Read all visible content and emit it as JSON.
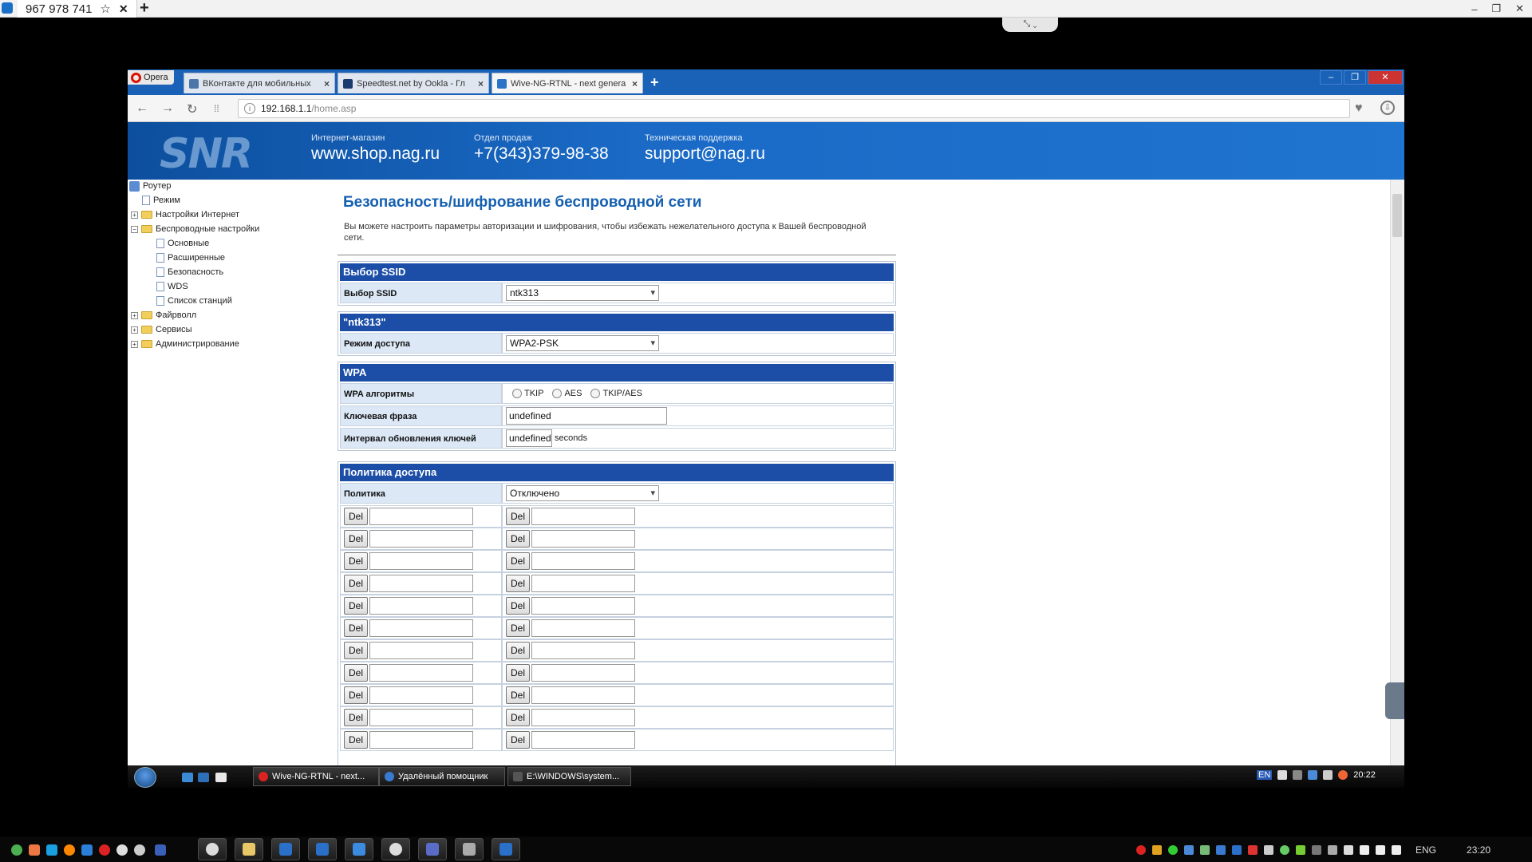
{
  "teamviewer": {
    "tab_label": "967 978 741",
    "star": "☆",
    "close": "✕",
    "plus": "+",
    "minimize": "‒",
    "restore": "❐",
    "close_win": "✕",
    "drop_label": "⤡ ⌄"
  },
  "browser": {
    "opera_label": "Opera",
    "tabs": [
      {
        "label": "ВКонтакте для мобильных",
        "color": "#4a76a8"
      },
      {
        "label": "Speedtest.net by Ookla - Гл",
        "color": "#1a3b6e"
      },
      {
        "label": "Wive-NG-RTNL - next genera",
        "color": "#2a73c8"
      }
    ],
    "tab_close": "×",
    "new_tab": "+",
    "address_host": "192.168.1.1",
    "address_path": "/home.asp",
    "back": "←",
    "forward": "→",
    "reload": "↻",
    "speeddial": "⁞⁞",
    "info": "i",
    "heart": "♥",
    "download": "⇩",
    "win_min": "–",
    "win_max": "❐",
    "win_close": "✕"
  },
  "banner": {
    "logo": "SNR",
    "shop_caption": "Интернет-магазин",
    "shop_value": "www.shop.nag.ru",
    "sales_caption": "Отдел продаж",
    "sales_value": "+7(343)379-98-38",
    "support_caption": "Техническая поддержка",
    "support_value": "support@nag.ru"
  },
  "tree": {
    "root": "Роутер",
    "mode": "Режим",
    "internet": "Настройки Интернет",
    "wireless": "Беспроводные настройки",
    "basic": "Основные",
    "advanced": "Расширенные",
    "security": "Безопасность",
    "wds": "WDS",
    "stations": "Список станций",
    "firewall": "Файрволл",
    "services": "Сервисы",
    "admin": "Администрирование",
    "plus": "+",
    "minus": "−"
  },
  "page": {
    "title": "Безопасность/шифрование беспроводной сети",
    "description": "Вы можете настроить параметры авторизации и шифрования, чтобы избежать нежелательного доступа к Вашей беспроводной сети.",
    "ssid_section": "Выбор SSID",
    "ssid_label": "Выбор SSID",
    "ssid_value": "ntk313",
    "net_section": "\"ntk313\"",
    "mode_label": "Режим доступа",
    "mode_value": "WPA2-PSK",
    "wpa_section": "WPA",
    "alg_label": "WPA алгоритмы",
    "alg_tkip": "TKIP",
    "alg_aes": "AES",
    "alg_both": "TKIP/AES",
    "key_label": "Ключевая фраза",
    "key_value": "undefined",
    "interval_label": "Интервал обновления ключей",
    "interval_value": "undefined",
    "interval_unit": "seconds",
    "policy_section": "Политика доступа",
    "policy_label": "Политика",
    "policy_value": "Отключено",
    "del_label": "Del"
  },
  "xp_taskbar": {
    "tasks": [
      {
        "label": "Wive-NG-RTNL - next...",
        "color": "#d22"
      },
      {
        "label": "Удалённый помощник",
        "color": "#3a7ad0"
      },
      {
        "label": "E:\\WINDOWS\\system...",
        "color": "#555"
      }
    ],
    "lang": "EN",
    "time": "20:22"
  },
  "w7_taskbar": {
    "lang": "ENG",
    "time": "23:20"
  }
}
